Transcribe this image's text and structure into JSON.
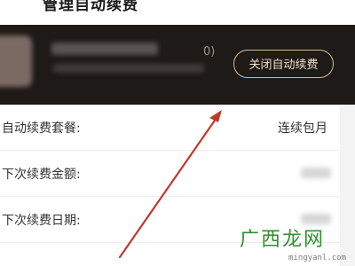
{
  "header": {
    "title": "管理自动续费"
  },
  "subscription": {
    "suffix": "0)",
    "close_button_label": "关闭自动续费"
  },
  "details": {
    "rows": [
      {
        "label": "自动续费套餐:",
        "value": "连续包月"
      },
      {
        "label": "下次续费金额:",
        "value": ""
      },
      {
        "label": "下次续费日期:",
        "value": ""
      }
    ]
  },
  "watermark": {
    "text": "广西龙网",
    "url": "mingyanl.com"
  },
  "colors": {
    "accent": "#d9b98c",
    "annotation_arrow": "#c0392b",
    "watermark": "#2e8f2e"
  }
}
